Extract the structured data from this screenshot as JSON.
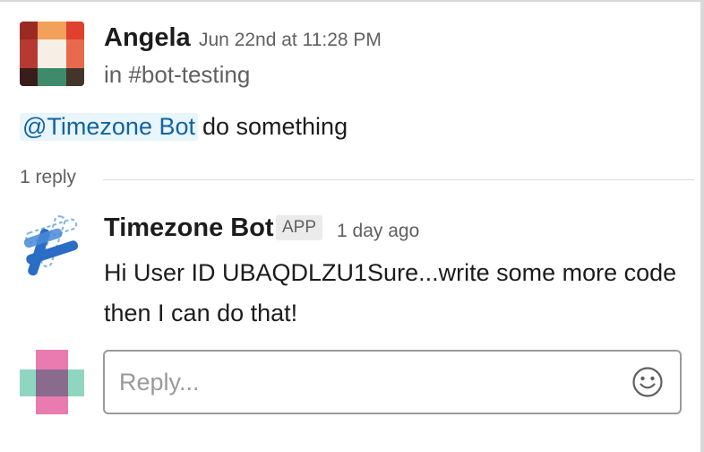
{
  "parent_message": {
    "author": "Angela",
    "timestamp": "Jun 22nd at 11:28 PM",
    "channel": "in #bot-testing",
    "mention": "@Timezone Bot",
    "text": "do something"
  },
  "thread": {
    "reply_count": "1 reply"
  },
  "reply_message": {
    "author": "Timezone Bot",
    "badge": "APP",
    "timestamp": "1 day ago",
    "text": "Hi User ID UBAQDLZU1Sure...write some more code then I can do that!"
  },
  "composer": {
    "placeholder": "Reply...",
    "value": "",
    "emoji_icon": "smiley-icon"
  },
  "colors": {
    "mention_text": "#1264a3",
    "mention_bg": "#e8f5fa",
    "muted_text": "#616061",
    "body_text": "#1d1c1d",
    "bot_blue": "#2b6cc4"
  }
}
